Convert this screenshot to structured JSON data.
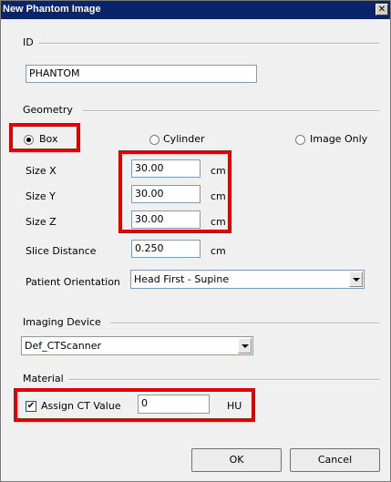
{
  "window": {
    "title": "New Phantom Image",
    "close_glyph": "✕"
  },
  "id_section": {
    "label": "ID",
    "value": "PHANTOM"
  },
  "geometry": {
    "label": "Geometry",
    "options": [
      {
        "label": "Box",
        "selected": true
      },
      {
        "label": "Cylinder",
        "selected": false
      },
      {
        "label": "Image Only",
        "selected": false
      }
    ],
    "size_x": {
      "label": "Size X",
      "value": "30.00",
      "unit": "cm"
    },
    "size_y": {
      "label": "Size Y",
      "value": "30.00",
      "unit": "cm"
    },
    "size_z": {
      "label": "Size Z",
      "value": "30.00",
      "unit": "cm"
    },
    "slice_distance": {
      "label": "Slice Distance",
      "value": "0.250",
      "unit": "cm"
    },
    "patient_orientation": {
      "label": "Patient Orientation",
      "value": "Head First - Supine"
    }
  },
  "imaging_device": {
    "label": "Imaging Device",
    "value": "Def_CTScanner"
  },
  "material": {
    "label": "Material",
    "assign_ct_checked": true,
    "assign_ct_label": "Assign CT Value",
    "ct_value": "0",
    "unit": "HU"
  },
  "buttons": {
    "ok": "OK",
    "cancel": "Cancel"
  },
  "colors": {
    "highlight": "#e00000",
    "titlebar": "#0a246a"
  }
}
